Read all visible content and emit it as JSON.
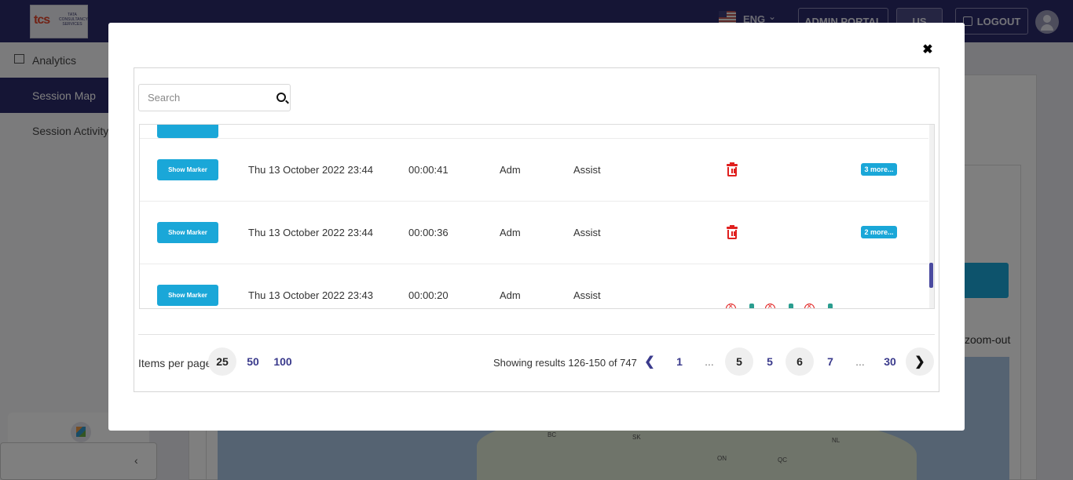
{
  "header": {
    "logo_text": "tcs",
    "logo_subtext": "TATA CONSULTANCY SERVICES",
    "language": "ENG",
    "admin_portal": "ADMIN PORTAL",
    "region": "US",
    "logout": "LOGOUT"
  },
  "sidebar": {
    "items": [
      {
        "label": "Analytics"
      },
      {
        "label": "Session Map"
      },
      {
        "label": "Session Activity"
      }
    ],
    "collapse_icon": "chevron-left-icon"
  },
  "background": {
    "zoom_label": "zoom-out",
    "map_labels": [
      "BC",
      "SK",
      "ON",
      "QC",
      "NL"
    ]
  },
  "modal": {
    "search_placeholder": "Search",
    "show_marker_label": "Show Marker",
    "rows": [
      {
        "date": "Thu 13 October 2022 23:44",
        "duration": "00:00:41",
        "user": "Adm",
        "type": "Assist",
        "more": "3 more..."
      },
      {
        "date": "Thu 13 October 2022 23:44",
        "duration": "00:00:36",
        "user": "Adm",
        "type": "Assist",
        "more": "2 more..."
      },
      {
        "date": "Thu 13 October 2022 23:43",
        "duration": "00:00:20",
        "user": "Adm",
        "type": "Assist",
        "more": ""
      }
    ],
    "pagination": {
      "items_per_page_label": "Items per page:",
      "page_sizes": [
        "25",
        "50",
        "100"
      ],
      "selected_size": "25",
      "showing": "Showing results 126-150 of 747",
      "pages": [
        "1",
        "...",
        "5",
        "5",
        "6",
        "7",
        "...",
        "30"
      ],
      "current_page": "6"
    }
  },
  "colors": {
    "header_bg": "#2b2a6b",
    "accent": "#1aa7d8",
    "delete": "#e0201f",
    "link": "#3a3a8c"
  }
}
